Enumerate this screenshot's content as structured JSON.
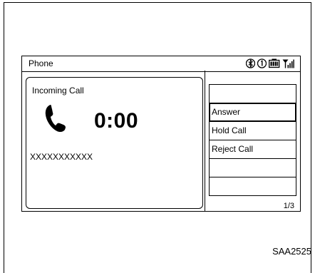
{
  "screen": {
    "title": "Phone",
    "status_icons": [
      "bluetooth-icon",
      "info-icon",
      "battery-icon",
      "signal-icon"
    ]
  },
  "call": {
    "label": "Incoming Call",
    "timer": "0:00",
    "caller_number": "XXXXXXXXXXX"
  },
  "menu": {
    "items": [
      {
        "label": "",
        "selected": false
      },
      {
        "label": "Answer",
        "selected": true
      },
      {
        "label": "Hold Call",
        "selected": false
      },
      {
        "label": "Reject Call",
        "selected": false
      },
      {
        "label": "",
        "selected": false
      },
      {
        "label": "",
        "selected": false
      }
    ],
    "page_indicator": "1/3"
  },
  "figure_code": "SAA2525"
}
